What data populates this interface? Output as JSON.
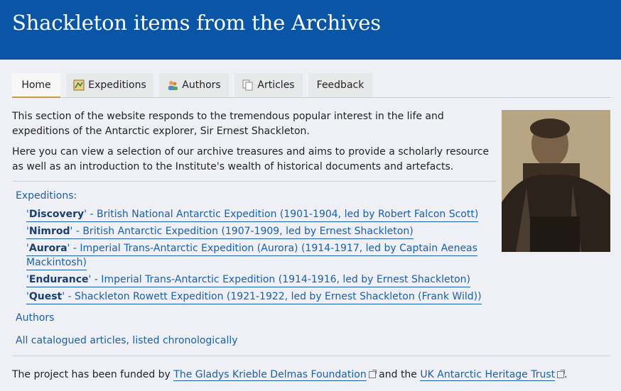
{
  "header": {
    "title": "Shackleton items from the Archives"
  },
  "tabs": [
    {
      "label": "Home",
      "icon": ""
    },
    {
      "label": "Expeditions",
      "icon": "map-icon"
    },
    {
      "label": "Authors",
      "icon": "people-icon"
    },
    {
      "label": "Articles",
      "icon": "documents-icon"
    },
    {
      "label": "Feedback",
      "icon": ""
    }
  ],
  "intro": {
    "p1": "This section of the website responds to the tremendous popular interest in the life and expeditions of the Antarctic explorer, Sir Ernest Shackleton.",
    "p2": "Here you can view a selection of our archive treasures and aims to provide a scholarly resource as well as an introduction to the Institute's wealth of historical documents and artefacts."
  },
  "links": {
    "expeditions_heading": "Expeditions:",
    "expeditions": [
      {
        "name": "Discovery",
        "desc": " - British National Antarctic Expedition (1901-1904, led by Robert Falcon Scott)"
      },
      {
        "name": "Nimrod",
        "desc": " - British Antarctic Expedition (1907-1909, led by Ernest Shackleton)"
      },
      {
        "name": "Aurora",
        "desc": " - Imperial Trans-Antarctic Expedition (Aurora) (1914-1917, led by Captain Aeneas",
        "desc2": "Mackintosh)"
      },
      {
        "name": "Endurance",
        "desc": " - Imperial Trans-Antarctic Expedition (1914-1916, led by Ernest Shackleton)"
      },
      {
        "name": "Quest",
        "desc": " - Shackleton Rowett Expedition (1921-1922, led by Ernest Shackleton (Frank Wild))"
      }
    ],
    "authors": "Authors",
    "articles": "All catalogued articles, listed chronologically"
  },
  "footer": {
    "prefix": "The project has been funded by ",
    "link1": "The Gladys Krieble Delmas Foundation",
    "middle": " and the ",
    "link2": "UK Antarctic Heritage Trust",
    "suffix": "."
  },
  "colors": {
    "header_bg": "#0a55a5",
    "link": "#1a5fa8",
    "active_tab_underline": "#c99a3a"
  }
}
